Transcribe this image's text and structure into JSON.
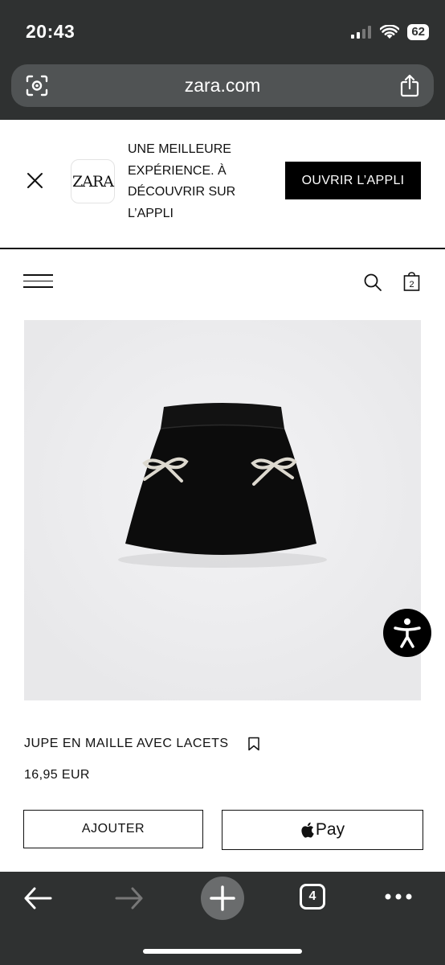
{
  "status_bar": {
    "time": "20:43",
    "battery": "62"
  },
  "browser": {
    "url": "zara.com",
    "tab_count": "4"
  },
  "app_banner": {
    "logo_text": "ZARA",
    "message": "UNE MEILLEURE EXPÉRIENCE. À DÉCOUVRIR SUR L’APPLI",
    "open_button": "OUVRIR L’APPLI"
  },
  "header": {
    "cart_count": "2"
  },
  "product": {
    "title": "JUPE EN MAILLE AVEC LACETS",
    "price": "16,95 EUR",
    "add_button": "AJOUTER",
    "pay_label": "Pay"
  },
  "icons": {
    "banner_close": "close-icon",
    "menu": "hamburger-menu-icon",
    "search": "search-icon",
    "cart": "shopping-bag-icon",
    "accessibility": "accessibility-icon",
    "bookmark": "bookmark-icon",
    "apple": "apple-logo-icon",
    "back": "arrow-left-icon",
    "forward": "arrow-right-icon",
    "new_tab": "plus-icon",
    "tabs": "tabs-icon",
    "more": "more-icon"
  }
}
